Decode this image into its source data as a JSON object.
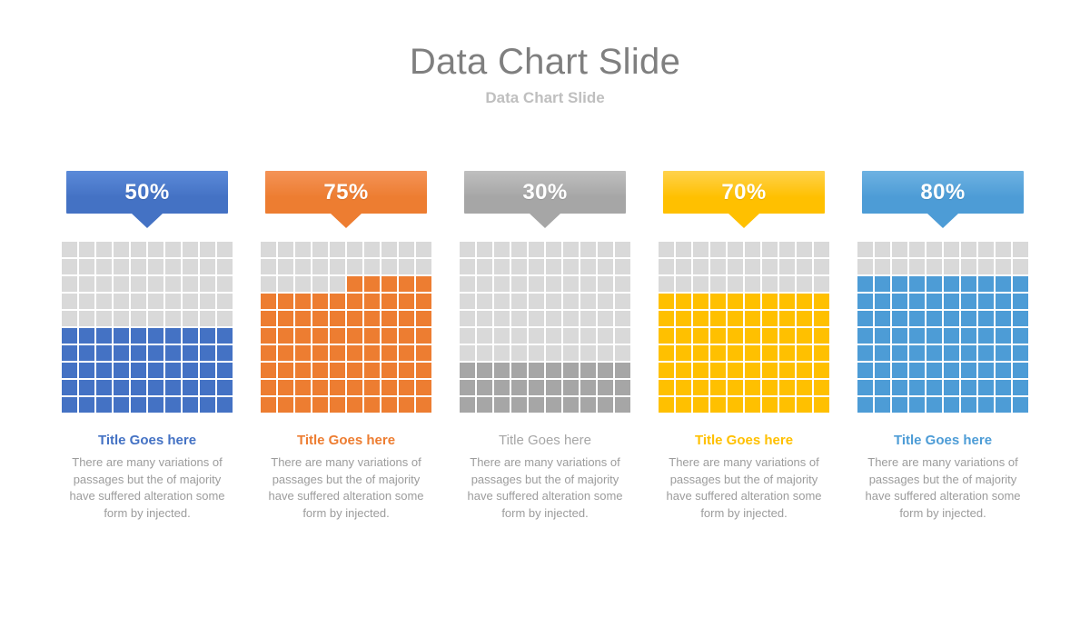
{
  "header": {
    "title": "Data Chart Slide",
    "subtitle": "Data Chart Slide"
  },
  "chart_data": {
    "type": "bar",
    "title": "Data Chart Slide",
    "subtitle": "Data Chart Slide",
    "chart_style": "waffle-grid-percentage",
    "grid": {
      "columns": 10,
      "rows": 10,
      "cell_value_percent": 1
    },
    "categories": [
      "Title Goes here",
      "Title Goes here",
      "Title Goes here",
      "Title Goes here",
      "Title Goes here"
    ],
    "values": [
      50,
      75,
      30,
      70,
      80
    ],
    "value_labels": [
      "50%",
      "75%",
      "30%",
      "70%",
      "80%"
    ],
    "ylim": [
      0,
      100
    ],
    "ylabel": "",
    "xlabel": "",
    "empty_cell_color": "#d9d9d9",
    "series_colors": [
      "#4472c4",
      "#ed7d31",
      "#a6a6a6",
      "#ffc000",
      "#4d9cd6"
    ]
  },
  "columns": [
    {
      "value": 50,
      "value_label": "50%",
      "color": "#4472c4",
      "color_light": "#5b8ad9",
      "title": "Title Goes here",
      "title_color": "#4472c4",
      "title_bold": true,
      "body": "There are many variations of passages but the of majority have suffered alteration some form by injected."
    },
    {
      "value": 75,
      "value_label": "75%",
      "color": "#ed7d31",
      "color_light": "#f49357",
      "title": "Title Goes here",
      "title_color": "#ed7d31",
      "title_bold": true,
      "body": "There are many variations of passages but the of majority have suffered alteration some form by injected."
    },
    {
      "value": 30,
      "value_label": "30%",
      "color": "#a6a6a6",
      "color_light": "#bfbfbf",
      "title": "Title Goes here",
      "title_color": "#a6a6a6",
      "title_bold": false,
      "body": "There are many variations of passages but the of majority have suffered alteration some form by injected."
    },
    {
      "value": 70,
      "value_label": "70%",
      "color": "#ffc000",
      "color_light": "#ffd24d",
      "title": "Title Goes here",
      "title_color": "#ffc000",
      "title_bold": true,
      "body": "There are many variations of passages but the of majority have suffered alteration some form by injected."
    },
    {
      "value": 80,
      "value_label": "80%",
      "color": "#4d9cd6",
      "color_light": "#6eb2e2",
      "title": "Title Goes here",
      "title_color": "#4d9cd6",
      "title_bold": true,
      "body": "There are many variations of passages but the of majority have suffered alteration some form by injected."
    }
  ]
}
